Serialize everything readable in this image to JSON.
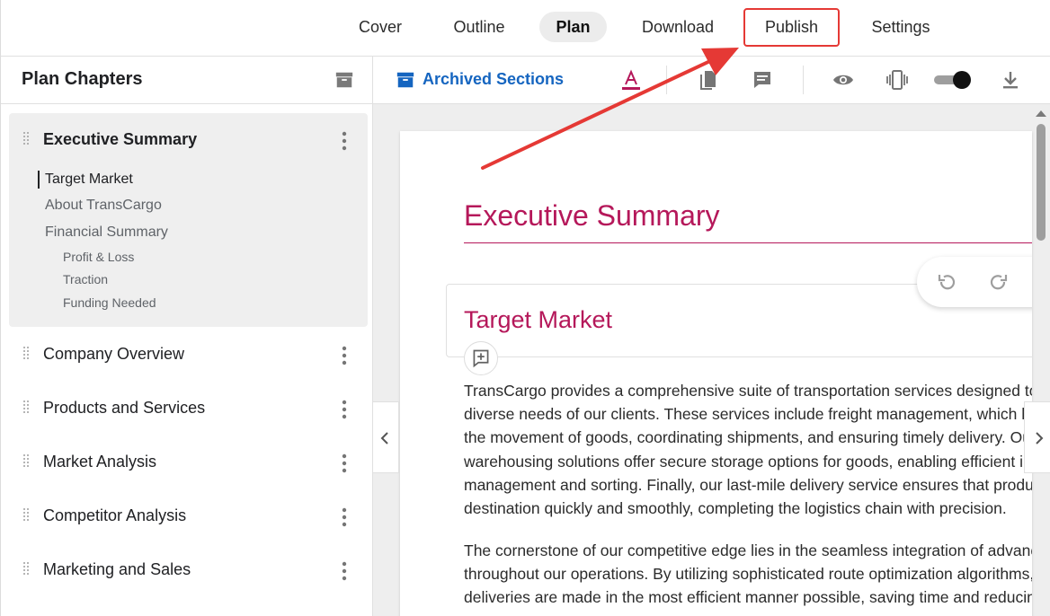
{
  "nav": {
    "tabs": [
      {
        "label": "Cover"
      },
      {
        "label": "Outline"
      },
      {
        "label": "Plan"
      },
      {
        "label": "Download"
      },
      {
        "label": "Publish"
      },
      {
        "label": "Settings"
      }
    ],
    "active": "Plan"
  },
  "sidebar": {
    "title": "Plan Chapters",
    "chapters": [
      {
        "name": "Executive Summary",
        "sections": [
          {
            "label": "Target Market"
          },
          {
            "label": "About TransCargo"
          },
          {
            "label": "Financial Summary"
          }
        ],
        "subsections": [
          {
            "label": "Profit & Loss"
          },
          {
            "label": "Traction"
          },
          {
            "label": "Funding Needed"
          }
        ]
      },
      {
        "name": "Company Overview"
      },
      {
        "name": "Products and Services"
      },
      {
        "name": "Market Analysis"
      },
      {
        "name": "Competitor Analysis"
      },
      {
        "name": "Marketing and Sales"
      }
    ]
  },
  "toolbar": {
    "archived_label": "Archived Sections",
    "icons": [
      "archive-icon",
      "text-color-icon",
      "document-icon",
      "comment-icon",
      "eye-icon",
      "device-preview-icon",
      "toggle-switch",
      "download-icon"
    ]
  },
  "document": {
    "chapter_title": "Executive Summary",
    "section_title": "Target Market",
    "paragraph1": [
      "TransCargo provides a comprehensive suite of transportation services designed to meet the",
      "diverse needs of our clients. These services include freight management, which handles",
      "the movement of goods, coordinating shipments, and ensuring timely delivery. Our",
      "warehousing solutions offer secure storage options for goods, enabling efficient inventory",
      "management and sorting. Finally, our last-mile delivery service ensures that products reach their",
      "destination quickly and smoothly, completing the logistics chain with precision."
    ],
    "paragraph2": [
      "The cornerstone of our competitive edge lies in the seamless integration of advanced technology",
      "throughout our operations. By utilizing sophisticated route optimization algorithms, we ensure",
      "deliveries are made in the most efficient manner possible, saving time and reducing costs."
    ]
  },
  "colors": {
    "accent_heading": "#b5185a",
    "link_blue": "#1565c0",
    "annotation_red": "#e53935"
  }
}
